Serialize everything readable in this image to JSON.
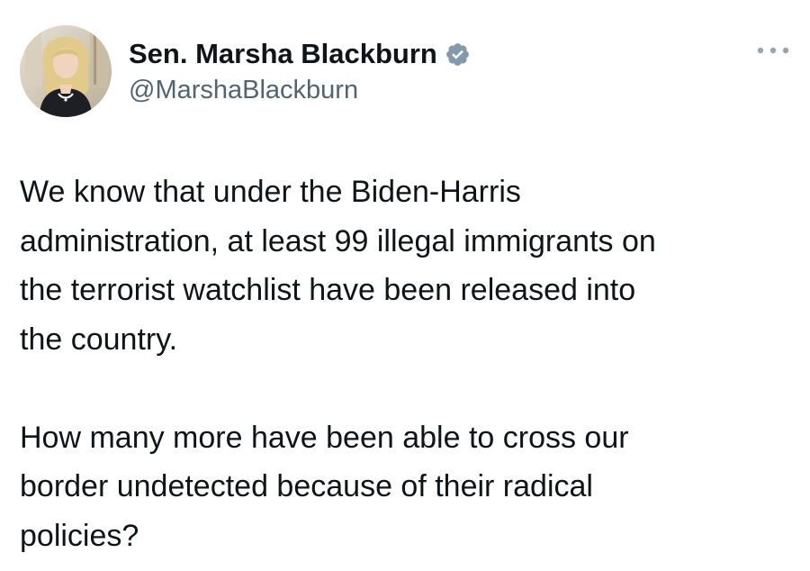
{
  "author": {
    "display_name": "Sen. Marsha Blackburn",
    "handle": "@MarshaBlackburn",
    "verified": true,
    "verified_color": "#829aab",
    "avatar_icon": "profile-photo"
  },
  "menu": {
    "more_icon": "more-horizontal-icon",
    "icon_color": "#9aa5ae"
  },
  "tweet": {
    "paragraphs": [
      {
        "lines": [
          "We know that under the Biden-Harris",
          "administration, at least 99 illegal immigrants on",
          "the terrorist watchlist have been released into",
          "the country."
        ]
      },
      {
        "lines": [
          "How many more have been able to cross our",
          "border undetected because of their radical",
          "policies?"
        ]
      }
    ]
  }
}
